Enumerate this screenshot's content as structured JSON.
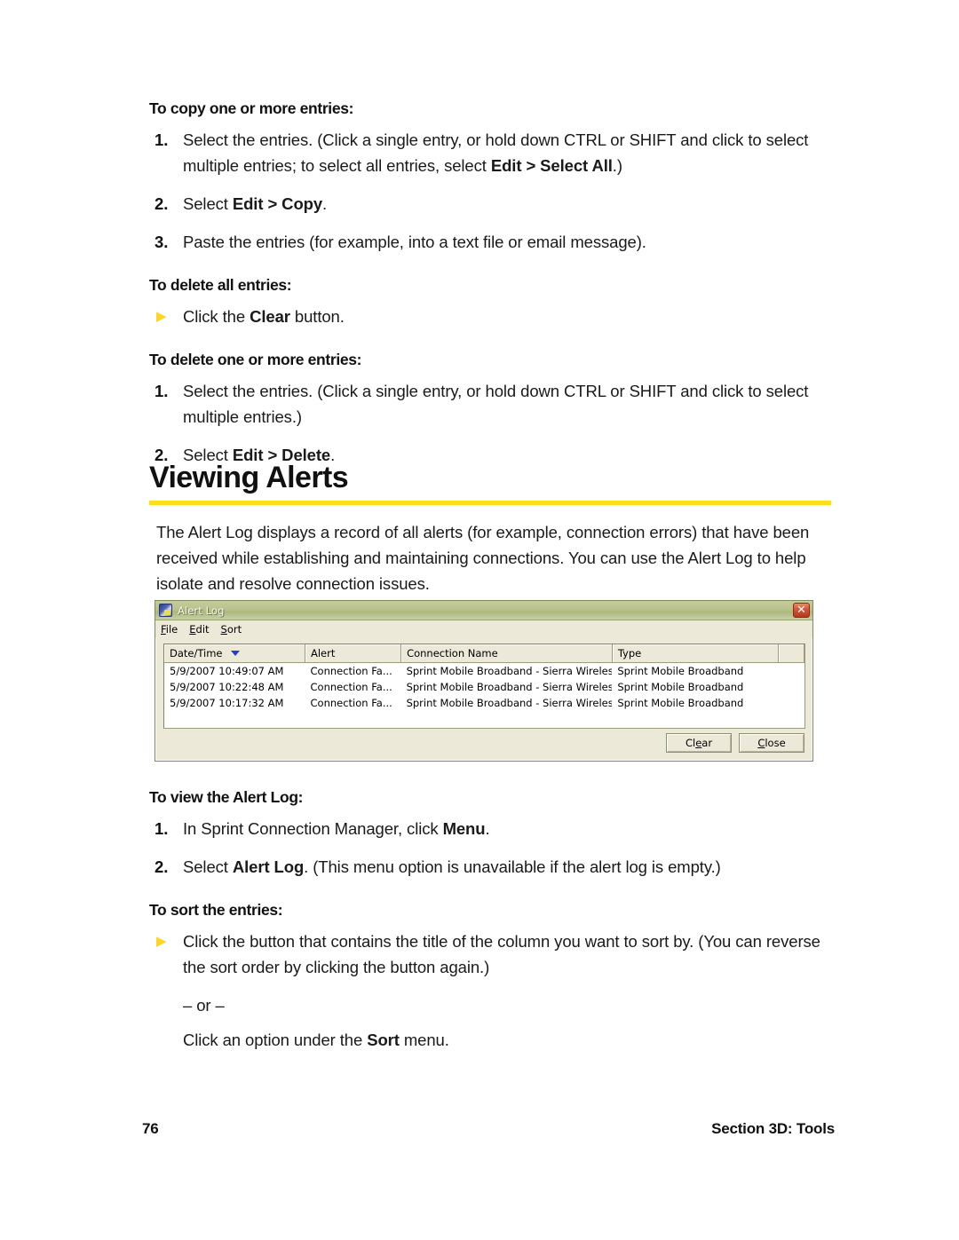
{
  "colors": {
    "accent_rule": "#FFDE17",
    "bullet_triangle": "#FFD521",
    "sort_caret": "#1E3FD2",
    "dialog_face": "#ECE9D8",
    "titlebar_green": "#B9C28C",
    "close_red": "#D4573B"
  },
  "doc": {
    "copy_section": {
      "heading": "To copy one or more entries:",
      "steps": [
        {
          "number": "1.",
          "parts": [
            {
              "text": "Select the entries. (Click a single entry, or hold down CTRL or SHIFT and click to select multiple entries; to select all entries, select ",
              "bold": false
            },
            {
              "text": "Edit > Select All",
              "bold": true
            },
            {
              "text": ".)",
              "bold": false
            }
          ]
        },
        {
          "number": "2.",
          "parts": [
            {
              "text": "Select ",
              "bold": false
            },
            {
              "text": "Edit > Copy",
              "bold": true
            },
            {
              "text": ".",
              "bold": false
            }
          ]
        },
        {
          "number": "3.",
          "parts": [
            {
              "text": "Paste the entries (for example, into a text file or email message).",
              "bold": false
            }
          ]
        }
      ]
    },
    "delete_all_section": {
      "heading": "To delete all entries:",
      "steps": [
        {
          "number": "▶",
          "is_bullet": true,
          "parts": [
            {
              "text": "Click the ",
              "bold": false
            },
            {
              "text": "Clear",
              "bold": true
            },
            {
              "text": " button.",
              "bold": false
            }
          ]
        }
      ]
    },
    "delete_some_section": {
      "heading": "To delete one or more entries:",
      "steps": [
        {
          "number": "1.",
          "parts": [
            {
              "text": "Select the entries. (Click a single entry, or hold down CTRL or SHIFT and click to select multiple entries.)",
              "bold": false
            }
          ]
        },
        {
          "number": "2.",
          "parts": [
            {
              "text": "Select ",
              "bold": false
            },
            {
              "text": "Edit > Delete",
              "bold": true
            },
            {
              "text": ".",
              "bold": false
            }
          ]
        }
      ]
    },
    "section_title": "Viewing Alerts",
    "intro": "The Alert Log displays a record of all alerts (for example, connection errors) that have been received while establishing and maintaining connections. You can use the Alert Log to help isolate and resolve connection issues.",
    "view_section": {
      "heading": "To view the Alert Log:",
      "steps": [
        {
          "number": "1.",
          "parts": [
            {
              "text": "In Sprint Connection Manager, click ",
              "bold": false
            },
            {
              "text": "Menu",
              "bold": true
            },
            {
              "text": ".",
              "bold": false
            }
          ]
        },
        {
          "number": "2.",
          "parts": [
            {
              "text": "Select ",
              "bold": false
            },
            {
              "text": "Alert Log",
              "bold": true
            },
            {
              "text": ". (This menu option is unavailable if the alert log is empty.)",
              "bold": false
            }
          ]
        }
      ]
    },
    "sort_section": {
      "heading": "To sort the entries:",
      "steps": [
        {
          "number": "▶",
          "is_bullet": true,
          "parts": [
            {
              "text": "Click the button that contains the title of the column you want to sort by. (You can reverse the sort order by clicking the button again.)",
              "bold": false
            }
          ]
        }
      ],
      "or_text": "– or –",
      "alt_parts": [
        {
          "text": "Click an option under the ",
          "bold": false
        },
        {
          "text": "Sort",
          "bold": true
        },
        {
          "text": " menu.",
          "bold": false
        }
      ]
    }
  },
  "dialog": {
    "title": "Alert Log",
    "icon": "alert-log-app-icon",
    "close_label": "✕",
    "menus": [
      {
        "label": "File",
        "accel": "F"
      },
      {
        "label": "Edit",
        "accel": "E"
      },
      {
        "label": "Sort",
        "accel": "S"
      }
    ],
    "table": {
      "columns": [
        {
          "label": "Date/Time",
          "sorted": true,
          "sort_direction": "descending",
          "width": "22%"
        },
        {
          "label": "Alert",
          "sorted": false,
          "width": "15%"
        },
        {
          "label": "Connection Name",
          "sorted": false,
          "width": "33%"
        },
        {
          "label": "Type",
          "sorted": false,
          "width": "26%"
        },
        {
          "label": "",
          "sorted": false,
          "width": "4%"
        }
      ],
      "rows": [
        {
          "datetime": "5/9/2007 10:49:07 AM",
          "alert": "Connection Fa...",
          "connection_name": "Sprint Mobile Broadband - Sierra Wireless",
          "type": "Sprint Mobile Broadband"
        },
        {
          "datetime": "5/9/2007 10:22:48 AM",
          "alert": "Connection Fa...",
          "connection_name": "Sprint Mobile Broadband - Sierra Wireless",
          "type": "Sprint Mobile Broadband"
        },
        {
          "datetime": "5/9/2007 10:17:32 AM",
          "alert": "Connection Fa...",
          "connection_name": "Sprint Mobile Broadband - Sierra Wireless",
          "type": "Sprint Mobile Broadband"
        }
      ]
    },
    "buttons": [
      {
        "label": "Clear",
        "accel_index": 2
      },
      {
        "label": "Close",
        "accel_index": 0
      }
    ]
  },
  "footer": {
    "page_number": "76",
    "section_label": "Section 3D: Tools"
  }
}
